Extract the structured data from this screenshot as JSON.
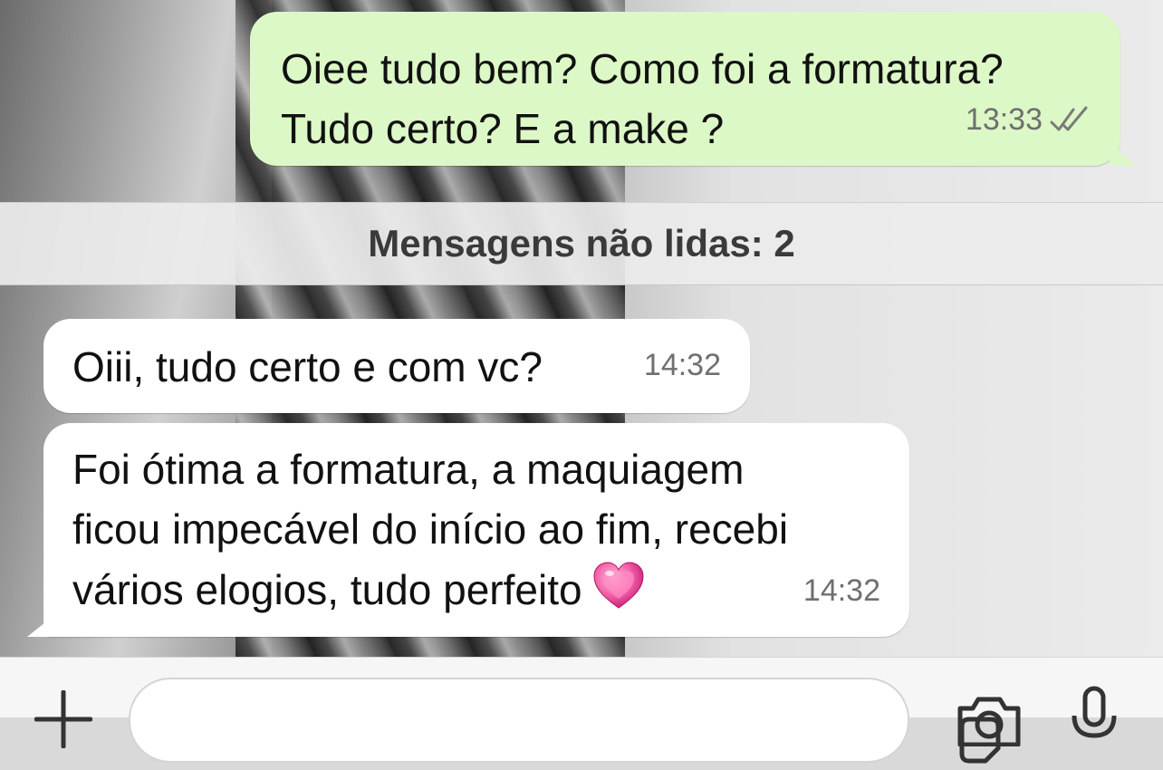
{
  "messages": [
    {
      "direction": "outgoing",
      "lines": [
        "Oiee tudo bem? Como foi a formatura?",
        "Tudo certo? E a make ?"
      ],
      "time": "13:33",
      "status_icon": "double-check-icon"
    },
    {
      "direction": "incoming",
      "lines": [
        "Oiii, tudo certo e com vc?"
      ],
      "time": "14:32"
    },
    {
      "direction": "incoming",
      "lines": [
        "Foi ótima a formatura, a maquiagem",
        "ficou impecável do início ao fim, recebi",
        "vários elogios, tudo perfeito"
      ],
      "emoji": "heart-emoji",
      "time": "14:32"
    }
  ],
  "unread_divider": "Mensagens não lidas: 2",
  "input_bar": {
    "icons": [
      "plus-icon",
      "sticker-icon",
      "camera-icon",
      "microphone-icon"
    ]
  },
  "colors": {
    "outgoing_bubble": "#dcf8c6",
    "incoming_bubble": "#ffffff",
    "timestamp": "#6f6f6f"
  }
}
